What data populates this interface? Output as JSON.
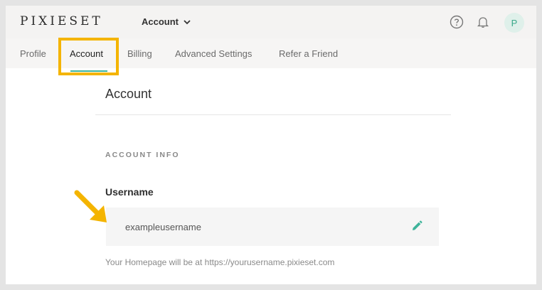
{
  "header": {
    "logo": "PIXIESET",
    "account_menu_label": "Account",
    "avatar_initial": "P"
  },
  "tabs": [
    {
      "label": "Profile"
    },
    {
      "label": "Account",
      "active": true
    },
    {
      "label": "Billing"
    },
    {
      "label": "Advanced Settings"
    },
    {
      "label": "Refer a Friend"
    }
  ],
  "main": {
    "title": "Account",
    "section_label": "ACCOUNT INFO",
    "username_label": "Username",
    "username_value": "exampleusername",
    "helper_text": "Your Homepage will be at https://yourusername.pixieset.com"
  },
  "icons": {
    "help": "question-circle-icon",
    "notifications": "bell-icon",
    "edit": "pencil-icon",
    "menu_toggle": "chevron-down-icon"
  },
  "colors": {
    "accent": "#3db39a",
    "highlight": "#f4b400",
    "topbar_bg": "#f4f3f2"
  }
}
